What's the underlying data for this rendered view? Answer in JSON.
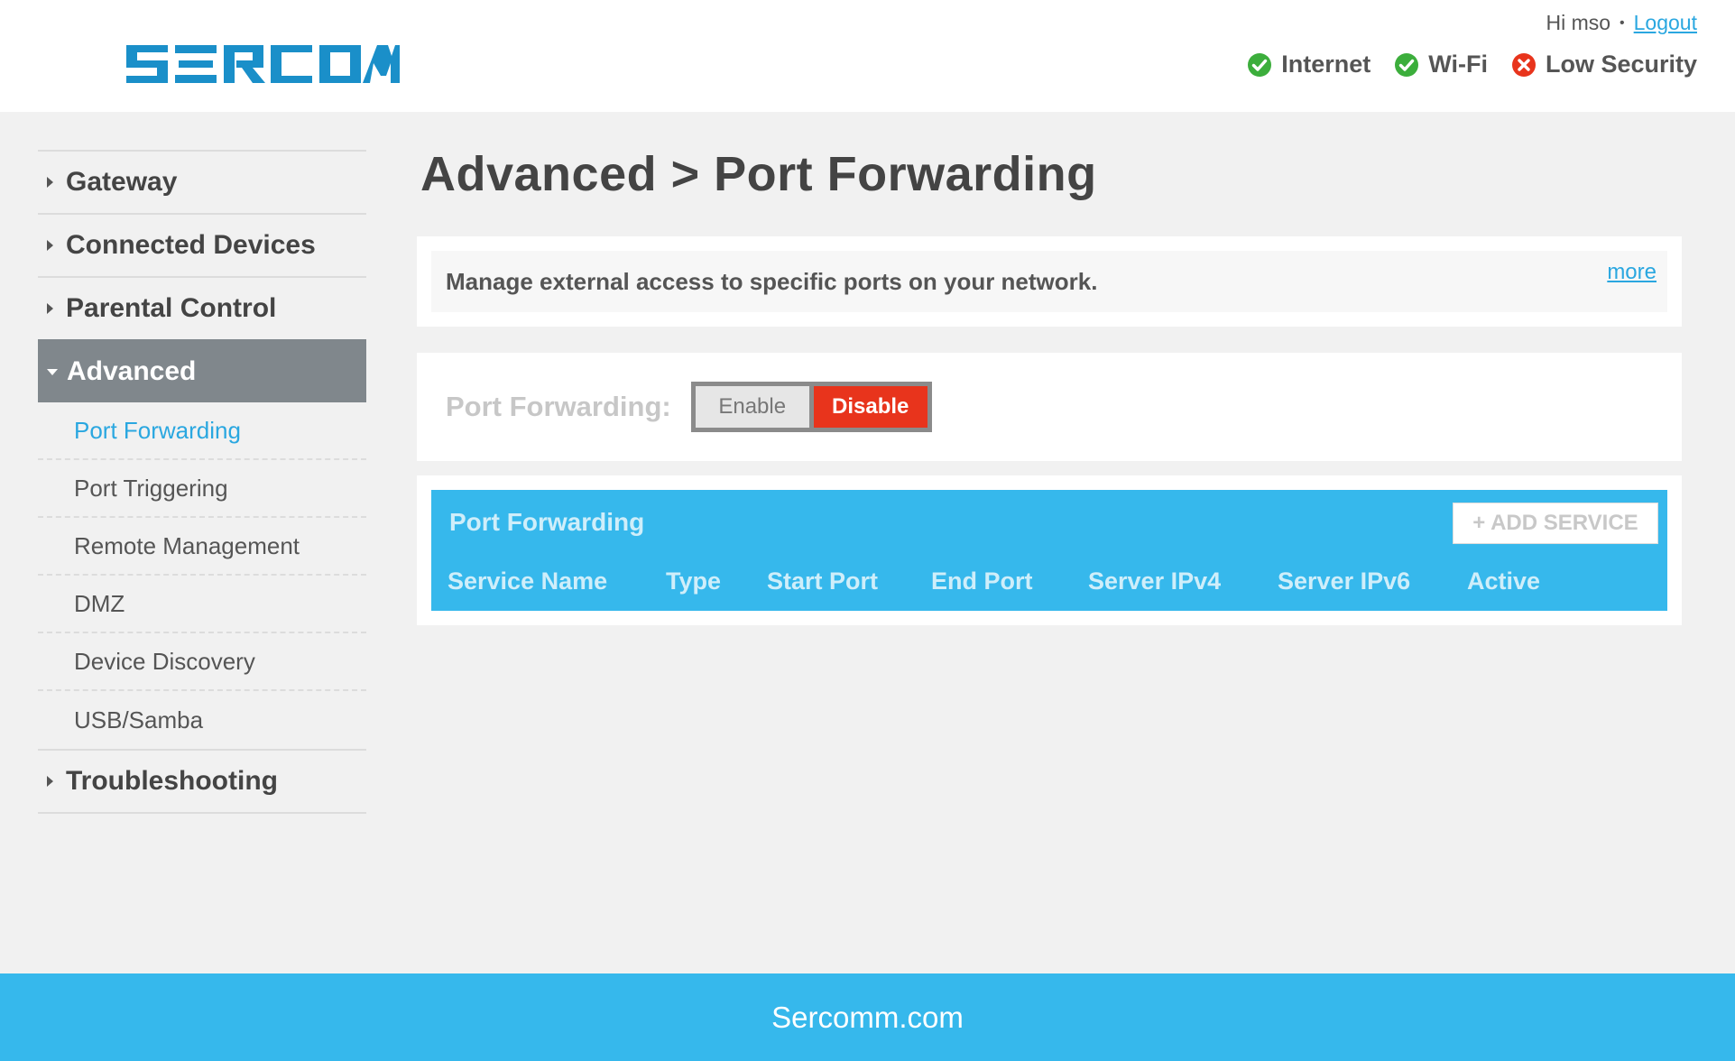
{
  "brand": {
    "name": "SERCOMM",
    "logo_color": "#1a8fc9"
  },
  "header": {
    "greeting": "Hi mso",
    "logout_label": "Logout",
    "status": [
      {
        "label": "Internet",
        "state": "ok",
        "icon": "check-circle-icon",
        "color": "#3cae3c"
      },
      {
        "label": "Wi-Fi",
        "state": "ok",
        "icon": "check-circle-icon",
        "color": "#3cae3c"
      },
      {
        "label": "Low Security",
        "state": "warning",
        "icon": "x-circle-icon",
        "color": "#e8341c"
      }
    ]
  },
  "sidebar": {
    "items": [
      {
        "label": "Gateway"
      },
      {
        "label": "Connected Devices"
      },
      {
        "label": "Parental Control"
      },
      {
        "label": "Advanced",
        "expanded": true
      },
      {
        "label": "Troubleshooting"
      }
    ],
    "advanced_sub": [
      {
        "label": "Port Forwarding",
        "current": true
      },
      {
        "label": "Port Triggering"
      },
      {
        "label": "Remote Management"
      },
      {
        "label": "DMZ"
      },
      {
        "label": "Device Discovery"
      },
      {
        "label": "USB/Samba"
      }
    ]
  },
  "main": {
    "title": "Advanced > Port Forwarding",
    "description": "Manage external access to specific ports on your network.",
    "more_label": "more",
    "toggle": {
      "label": "Port Forwarding:",
      "enable_label": "Enable",
      "disable_label": "Disable",
      "selected": "Disable"
    },
    "table": {
      "title": "Port Forwarding",
      "add_label": "+ ADD SERVICE",
      "columns": [
        "Service Name",
        "Type",
        "Start Port",
        "End Port",
        "Server IPv4",
        "Server IPv6",
        "Active"
      ],
      "rows": []
    }
  },
  "footer": {
    "text": "Sercomm.com"
  },
  "colors": {
    "accent": "#36b8ec",
    "disable_red": "#e8341c",
    "nav_active": "#80878c"
  }
}
